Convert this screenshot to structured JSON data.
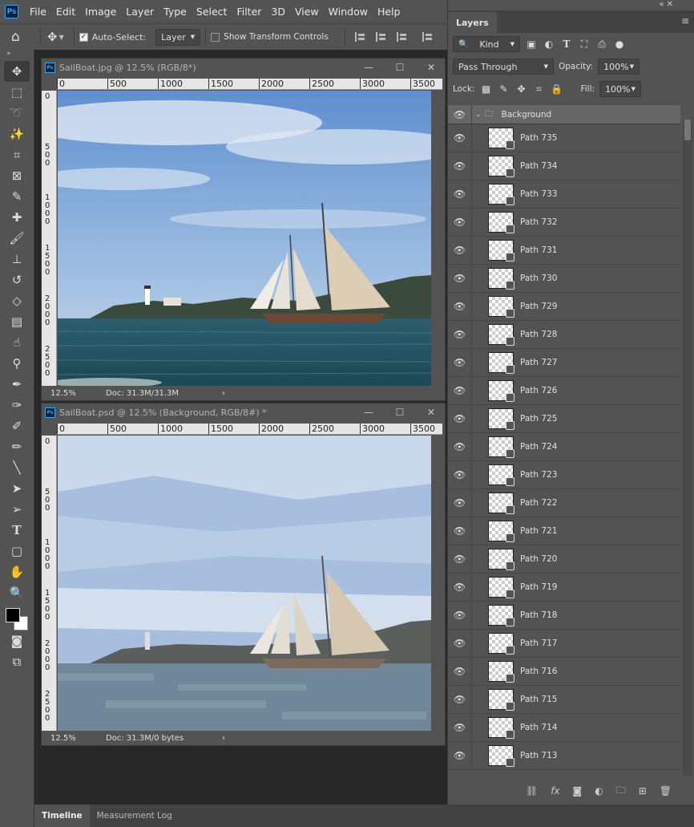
{
  "menubar": {
    "items": [
      "File",
      "Edit",
      "Image",
      "Layer",
      "Type",
      "Select",
      "Filter",
      "3D",
      "View",
      "Window",
      "Help"
    ]
  },
  "options": {
    "auto_select_label": "Auto-Select:",
    "target_value": "Layer",
    "transform_label": "Show Transform Controls"
  },
  "tools": [
    "move-tool",
    "marquee-tool",
    "lasso-tool",
    "magic-wand-tool",
    "crop-tool",
    "frame-tool",
    "eyedropper-tool",
    "healing-tool",
    "brush-tool",
    "stamp-tool",
    "history-brush-tool",
    "eraser-tool",
    "gradient-tool",
    "smudge-tool",
    "dodge-tool",
    "pen-tool",
    "freeform-pen-tool",
    "add-anchor-tool",
    "curvature-pen-tool",
    "line-tool",
    "path-selection-tool",
    "direct-selection-tool",
    "type-tool",
    "shape-tool",
    "hand-tool",
    "zoom-tool"
  ],
  "windows": [
    {
      "title": "SailBoat.jpg @ 12.5% (RGB/8*)",
      "zoom": "12.5%",
      "doc": "Doc: 31.3M/31.3M"
    },
    {
      "title": "SailBoat.psd @ 12.5% (Background, RGB/8#) *",
      "zoom": "12.5%",
      "doc": "Doc: 31.3M/0 bytes"
    }
  ],
  "ruler": {
    "h": [
      "0",
      "500",
      "1000",
      "1500",
      "2000",
      "2500",
      "3000",
      "3500"
    ],
    "v": [
      "0",
      "500",
      "1000",
      "1500",
      "2000",
      "2500"
    ]
  },
  "layers": {
    "tab": "Layers",
    "kind_label": "Kind",
    "blend_mode": "Pass Through",
    "opacity_label": "Opacity:",
    "opacity_value": "100%",
    "lock_label": "Lock:",
    "fill_label": "Fill:",
    "fill_value": "100%",
    "group_name": "Background",
    "items": [
      "Path 735",
      "Path 734",
      "Path 733",
      "Path 732",
      "Path 731",
      "Path 730",
      "Path 729",
      "Path 728",
      "Path 727",
      "Path 726",
      "Path 725",
      "Path 724",
      "Path 723",
      "Path 722",
      "Path 721",
      "Path 720",
      "Path 719",
      "Path 718",
      "Path 717",
      "Path 716",
      "Path 715",
      "Path 714",
      "Path 713"
    ]
  },
  "bottom": {
    "tabs": [
      "Timeline",
      "Measurement Log"
    ]
  }
}
